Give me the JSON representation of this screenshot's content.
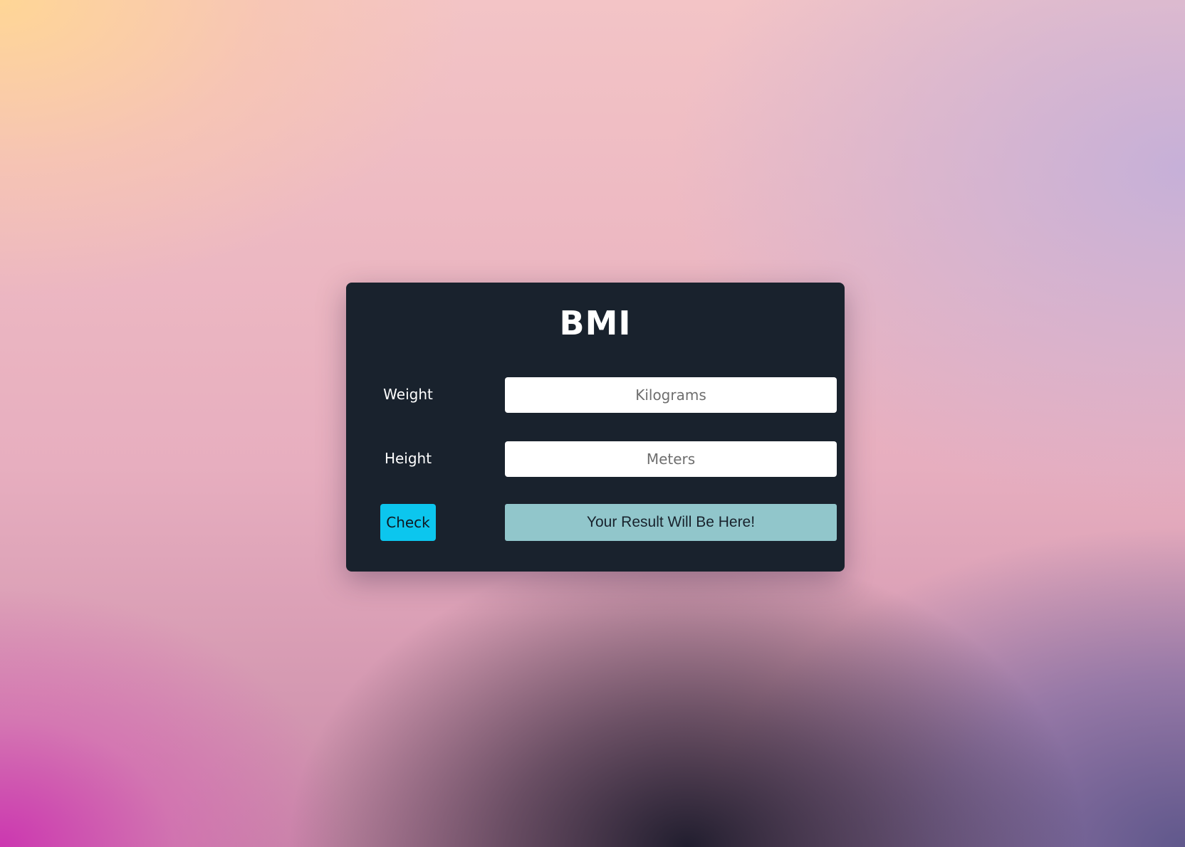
{
  "card": {
    "title": "BMI"
  },
  "weight": {
    "label": "Weight",
    "placeholder": "Kilograms",
    "value": ""
  },
  "height": {
    "label": "Height",
    "placeholder": "Meters",
    "value": ""
  },
  "action": {
    "check_label": "Check",
    "result_text": "Your Result Will Be Here!"
  },
  "colors": {
    "card_background": "#19222d",
    "button_accent": "#0cc6ee",
    "result_background": "#91c6cb"
  }
}
